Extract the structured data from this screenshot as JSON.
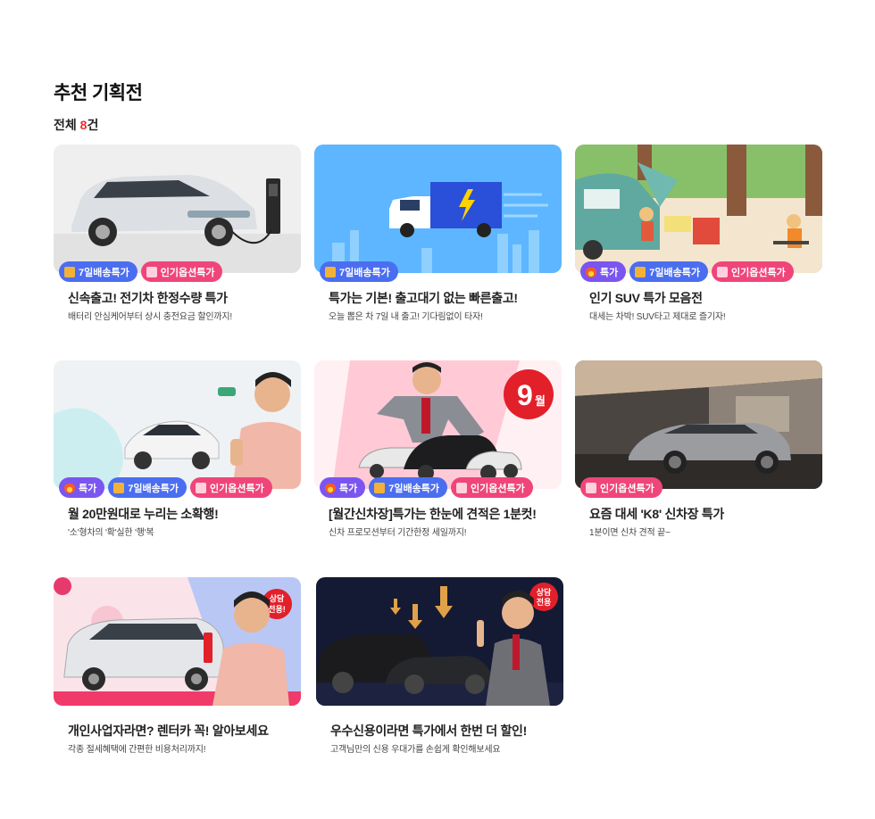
{
  "page": {
    "title": "추천 기획전",
    "count_prefix": "전체 ",
    "count_value": "8",
    "count_suffix": "건"
  },
  "cards": [
    {
      "title": "신속출고! 전기차 한정수량 특가",
      "subtitle": "배터리 안심케어부터 상시 충전요금 할인까지!",
      "badges": [
        "7일배송특가",
        "인기옵션특가"
      ]
    },
    {
      "title": "특가는 기본! 출고대기 없는 빠른출고!",
      "subtitle": "오늘 뽑은 차 7일 내 출고! 기다림없이 타자!",
      "badges": [
        "7일배송특가"
      ]
    },
    {
      "title": "인기 SUV 특가 모음전",
      "subtitle": "대세는 차박! SUV타고 제대로 즐기자!",
      "badges": [
        "특가",
        "7일배송특가",
        "인기옵션특가"
      ]
    },
    {
      "title": "월 20만원대로 누리는 소확행!",
      "subtitle": "'소'형차의 '확'실한 '행'복",
      "badges": [
        "특가",
        "7일배송특가",
        "인기옵션특가"
      ]
    },
    {
      "title": "[월간신차장]특가는 한눈에 견적은 1분컷!",
      "subtitle": "신차 프로모션부터 기간한정 세일까지!",
      "badges": [
        "특가",
        "7일배송특가",
        "인기옵션특가"
      ],
      "image_text": {
        "month_num": "9",
        "month_unit": "월"
      }
    },
    {
      "title": "요즘 대세 'K8' 신차장 특가",
      "subtitle": "1분이면 신차 견적 끝~",
      "badges": [
        "인기옵션특가"
      ]
    },
    {
      "title": "개인사업자라면? 렌터카 꼭! 알아보세요",
      "subtitle": "각종 절세혜택에 간편한 비용처리까지!",
      "badges": [],
      "image_text": {
        "stamp_line1": "상담",
        "stamp_line2": "전용!"
      }
    },
    {
      "title": "우수신용이라면 특가에서 한번 더 할인!",
      "subtitle": "고객님만의 신용 우대가를 손쉽게 확인해보세요",
      "badges": [],
      "image_text": {
        "stamp_line1": "상담",
        "stamp_line2": "전용"
      }
    }
  ],
  "colors": {
    "count_accent": "#e8302c",
    "badge_deal": "#7b55f0",
    "badge_ship": "#4b6ef0",
    "badge_pop": "#f0457a"
  },
  "icons": {
    "badge_deal": "fire-icon",
    "badge_ship": "box-icon",
    "badge_pop": "thumbs-up-icon"
  }
}
